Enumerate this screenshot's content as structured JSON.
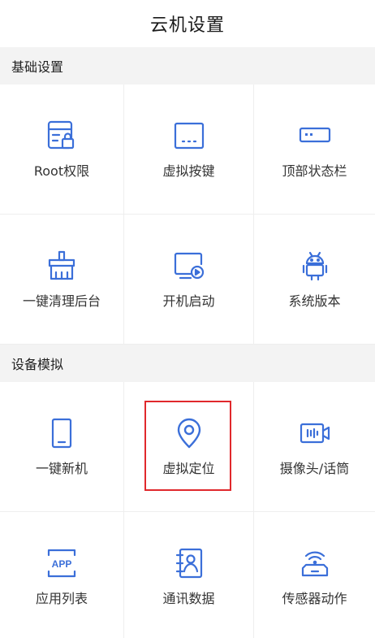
{
  "header": {
    "title": "云机设置"
  },
  "sections": [
    {
      "title": "基础设置",
      "items": [
        {
          "label": "Root权限",
          "icon": "root-permission-icon"
        },
        {
          "label": "虚拟按键",
          "icon": "virtual-keys-icon"
        },
        {
          "label": "顶部状态栏",
          "icon": "status-bar-icon"
        },
        {
          "label": "一键清理后台",
          "icon": "broom-clean-icon"
        },
        {
          "label": "开机启动",
          "icon": "boot-start-icon"
        },
        {
          "label": "系统版本",
          "icon": "android-icon"
        }
      ]
    },
    {
      "title": "设备模拟",
      "items": [
        {
          "label": "一键新机",
          "icon": "phone-icon"
        },
        {
          "label": "虚拟定位",
          "icon": "location-pin-icon"
        },
        {
          "label": "摄像头/话筒",
          "icon": "camera-mic-icon"
        },
        {
          "label": "应用列表",
          "icon": "app-list-icon"
        },
        {
          "label": "通讯数据",
          "icon": "contacts-book-icon"
        },
        {
          "label": "传感器动作",
          "icon": "sensor-icon"
        }
      ]
    }
  ],
  "colors": {
    "accent": "#3b6fd9",
    "highlight": "#e0282c",
    "section_bg": "#f3f3f3"
  }
}
